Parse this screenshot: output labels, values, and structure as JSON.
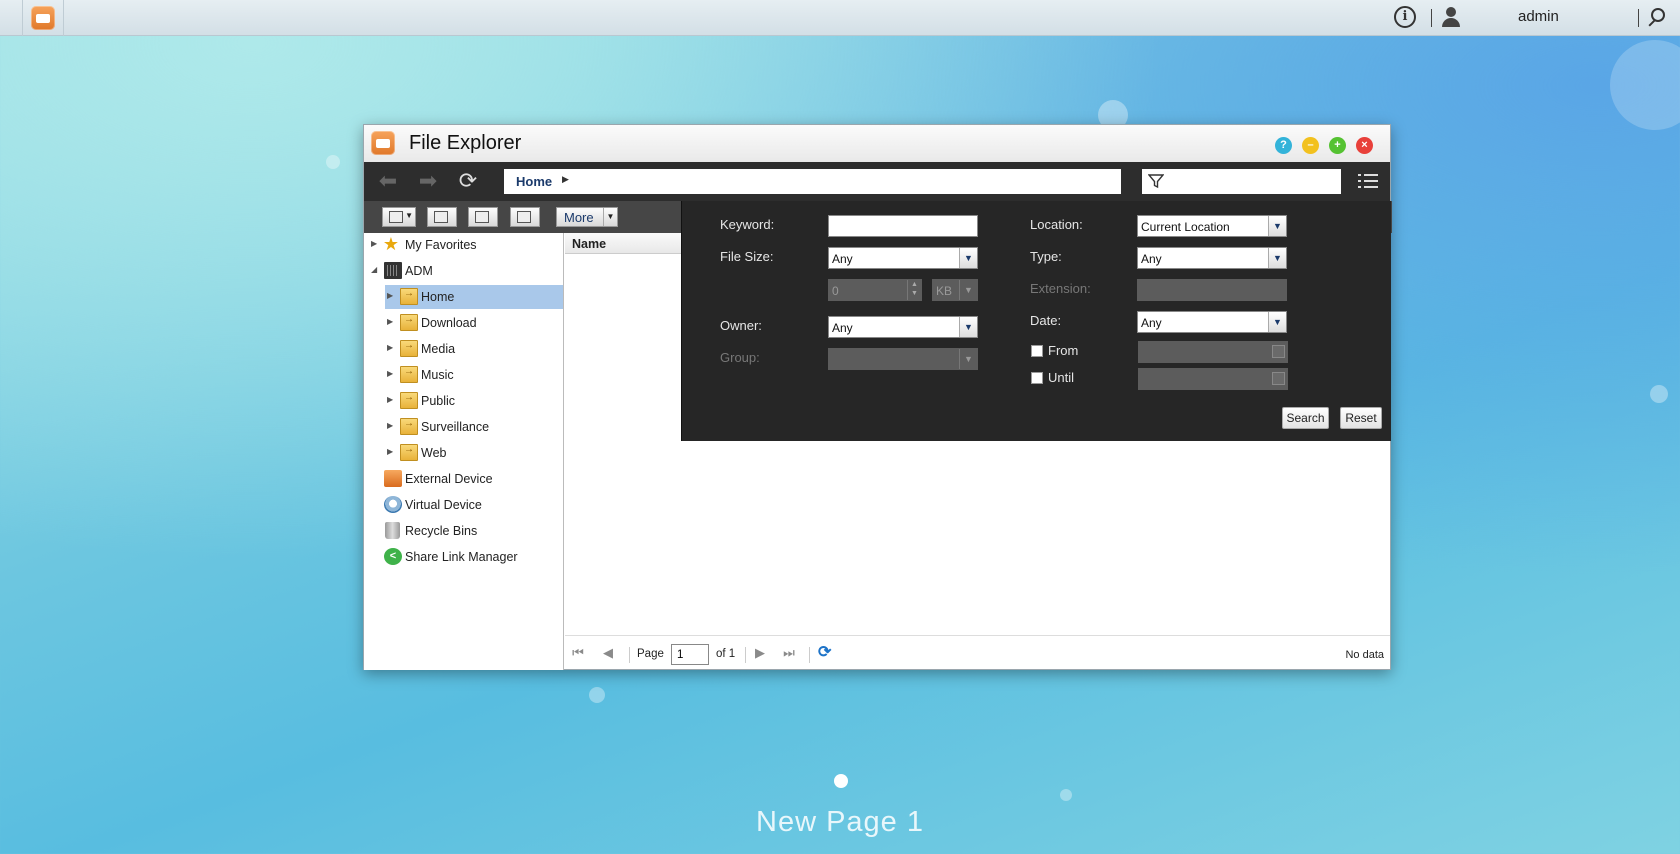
{
  "topbar": {
    "username": "admin",
    "icons": [
      "app-launcher-icon",
      "info-icon",
      "user-icon",
      "search-icon"
    ]
  },
  "window": {
    "title": "File Explorer",
    "buttons": [
      "help-icon",
      "minimize-icon",
      "maximize-icon",
      "close-icon"
    ],
    "breadcrumb": [
      "Home"
    ],
    "toolbar": {
      "more_label": "More"
    }
  },
  "tree": {
    "items": [
      {
        "label": "My Favorites",
        "icon": "star-icon"
      },
      {
        "label": "ADM",
        "icon": "nas-icon"
      },
      {
        "label": "Home",
        "icon": "folder-icon",
        "selected": true
      },
      {
        "label": "Download",
        "icon": "folder-icon"
      },
      {
        "label": "Media",
        "icon": "folder-icon"
      },
      {
        "label": "Music",
        "icon": "folder-icon"
      },
      {
        "label": "Public",
        "icon": "folder-icon"
      },
      {
        "label": "Surveillance",
        "icon": "folder-icon"
      },
      {
        "label": "Web",
        "icon": "folder-icon"
      },
      {
        "label": "External Device",
        "icon": "external-device-icon"
      },
      {
        "label": "Virtual Device",
        "icon": "virtual-device-icon"
      },
      {
        "label": "Recycle Bins",
        "icon": "recycle-bin-icon"
      },
      {
        "label": "Share Link Manager",
        "icon": "share-icon"
      }
    ]
  },
  "filelist": {
    "column_name": "Name"
  },
  "pager": {
    "page_label": "Page",
    "page_value": "1",
    "of_label": "of 1",
    "status": "No data"
  },
  "search": {
    "keyword_label": "Keyword:",
    "keyword_value": "",
    "filesize_label": "File Size:",
    "filesize_value": "Any",
    "size_amount": "0",
    "size_unit": "KB",
    "owner_label": "Owner:",
    "owner_value": "Any",
    "group_label": "Group:",
    "location_label": "Location:",
    "location_value": "Current Location",
    "type_label": "Type:",
    "type_value": "Any",
    "extension_label": "Extension:",
    "date_label": "Date:",
    "date_value": "Any",
    "from_label": "From",
    "until_label": "Until",
    "search_button": "Search",
    "reset_button": "Reset"
  },
  "desktop": {
    "page_name": "New Page 1"
  },
  "colors": {
    "selection": "#a9c8ea",
    "panel_bg": "#262626",
    "accent": "#1b3a6b"
  }
}
